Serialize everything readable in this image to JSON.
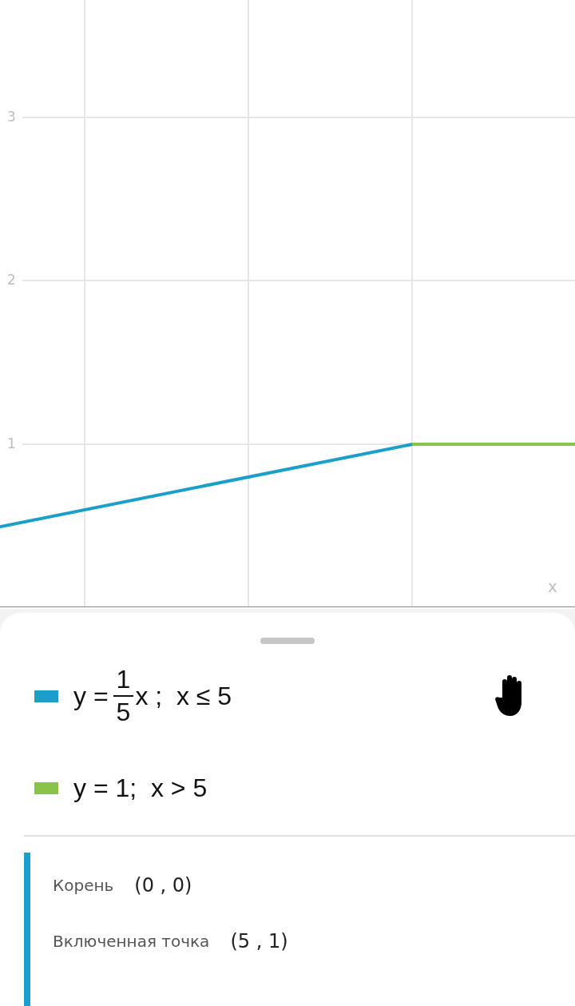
{
  "graph": {
    "y_tick_labels": [
      "3",
      "2",
      "1"
    ],
    "x_axis_label": "x"
  },
  "equations": [
    {
      "color": "#1a9fcb",
      "parts": [
        {
          "kind": "text",
          "text": "y ="
        },
        {
          "kind": "fraction",
          "numerator": "1",
          "denominator": "5"
        },
        {
          "kind": "text",
          "text": "x ;  x ≤ 5"
        }
      ]
    },
    {
      "color": "#8bc34a",
      "parts": [
        {
          "kind": "text",
          "text": "y = 1;  x > 5"
        }
      ]
    }
  ],
  "results": {
    "color": "#1a9fcb",
    "items": [
      {
        "label": "Корень",
        "value": "(0 , 0)"
      },
      {
        "label": "Включенная точка",
        "value": "(5 , 1)"
      }
    ]
  }
}
